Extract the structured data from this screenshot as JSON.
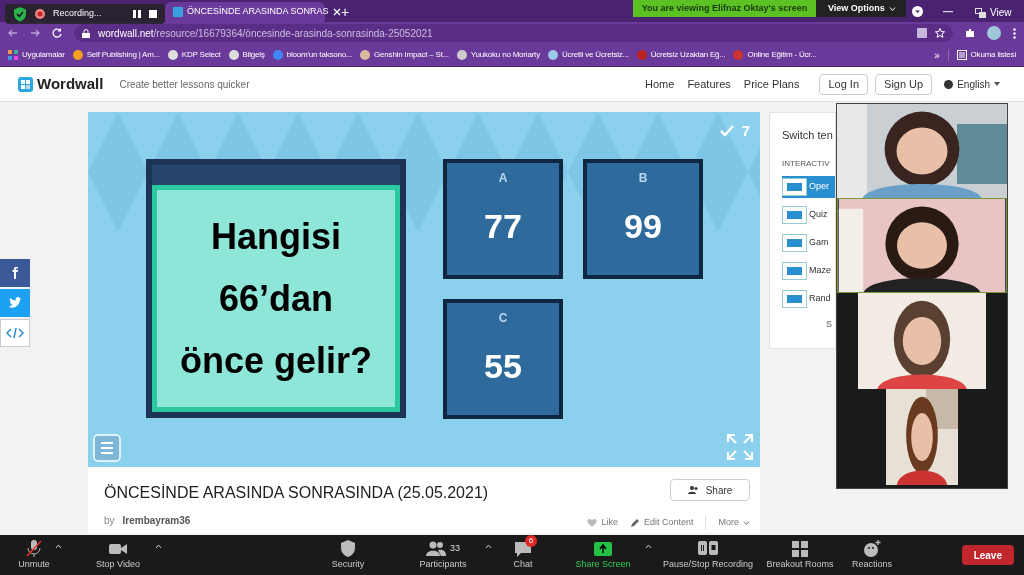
{
  "browser": {
    "recording": "Recording...",
    "tabs": [
      {
        "title": "ÖNCESİNDE ARASINDA SONRAS",
        "selected": true
      }
    ],
    "new_tab": "+",
    "url": {
      "domain": "wordwall.net",
      "path": "/resource/16679364/öncesinde-arasinda-sonrasinda-25052021"
    },
    "bookmarks": [
      {
        "label": "Uygulamalar"
      },
      {
        "label": "Self Publishing | Am..."
      },
      {
        "label": "KDP Select"
      },
      {
        "label": "Bilgelş"
      },
      {
        "label": "bloom'un taksono..."
      },
      {
        "label": "Genshin Impact – St..."
      },
      {
        "label": "Yuukoku no Moriarty"
      },
      {
        "label": "Ücretli ve Ücretsiz..."
      },
      {
        "label": "Ücretsiz Uzaktan Eğ..."
      },
      {
        "label": "Online Eğitim - Ücr..."
      }
    ],
    "more": "»",
    "reading_list": "Okuma listesi"
  },
  "zoom_banner": {
    "text": "You are viewing Elifnaz Oktay's screen",
    "view_options": "View Options",
    "view": "View"
  },
  "site": {
    "logo": "Wordwall",
    "tagline": "Create better lessons quicker",
    "nav": [
      "Home",
      "Features",
      "Price Plans"
    ],
    "buttons": [
      "Log In",
      "Sign Up"
    ],
    "language": "English"
  },
  "game": {
    "score": "7",
    "question": "Hangisi 66’dan önce gelir?",
    "answers": [
      {
        "letter": "A",
        "value": "77"
      },
      {
        "letter": "B",
        "value": "99"
      },
      {
        "letter": "C",
        "value": "55"
      }
    ]
  },
  "activity": {
    "title": "ÖNCESİNDE ARASINDA SONRASINDA (25.05.2021)",
    "by": "by",
    "author": "Irembayram36",
    "share": "Share",
    "actions": [
      "Like",
      "Edit Content",
      "More"
    ]
  },
  "templates": {
    "title": "Switch ten",
    "heading": "INTERACTIV",
    "items": [
      {
        "label": "Oper",
        "selected": true
      },
      {
        "label": "Quiz",
        "selected": false
      },
      {
        "label": "Gam",
        "selected": false
      },
      {
        "label": "Maze",
        "selected": false
      },
      {
        "label": "Rand",
        "selected": false
      }
    ],
    "more": "S"
  },
  "toolbar": {
    "items": [
      {
        "kind": "mic",
        "label": "Unmute",
        "caret": true
      },
      {
        "kind": "video",
        "label": "Stop Video",
        "caret": true
      },
      {
        "kind": "security",
        "label": "Security",
        "caret": false
      },
      {
        "kind": "participants",
        "label": "Participants",
        "count": "33",
        "caret": true
      },
      {
        "kind": "chat",
        "label": "Chat",
        "badge": "6",
        "caret": false
      },
      {
        "kind": "share",
        "label": "Share Screen",
        "caret": true
      },
      {
        "kind": "record",
        "label": "Pause/Stop Recording",
        "caret": false
      },
      {
        "kind": "breakout",
        "label": "Breakout Rooms",
        "caret": false
      },
      {
        "kind": "reactions",
        "label": "Reactions",
        "caret": false
      }
    ],
    "leave": "Leave"
  }
}
